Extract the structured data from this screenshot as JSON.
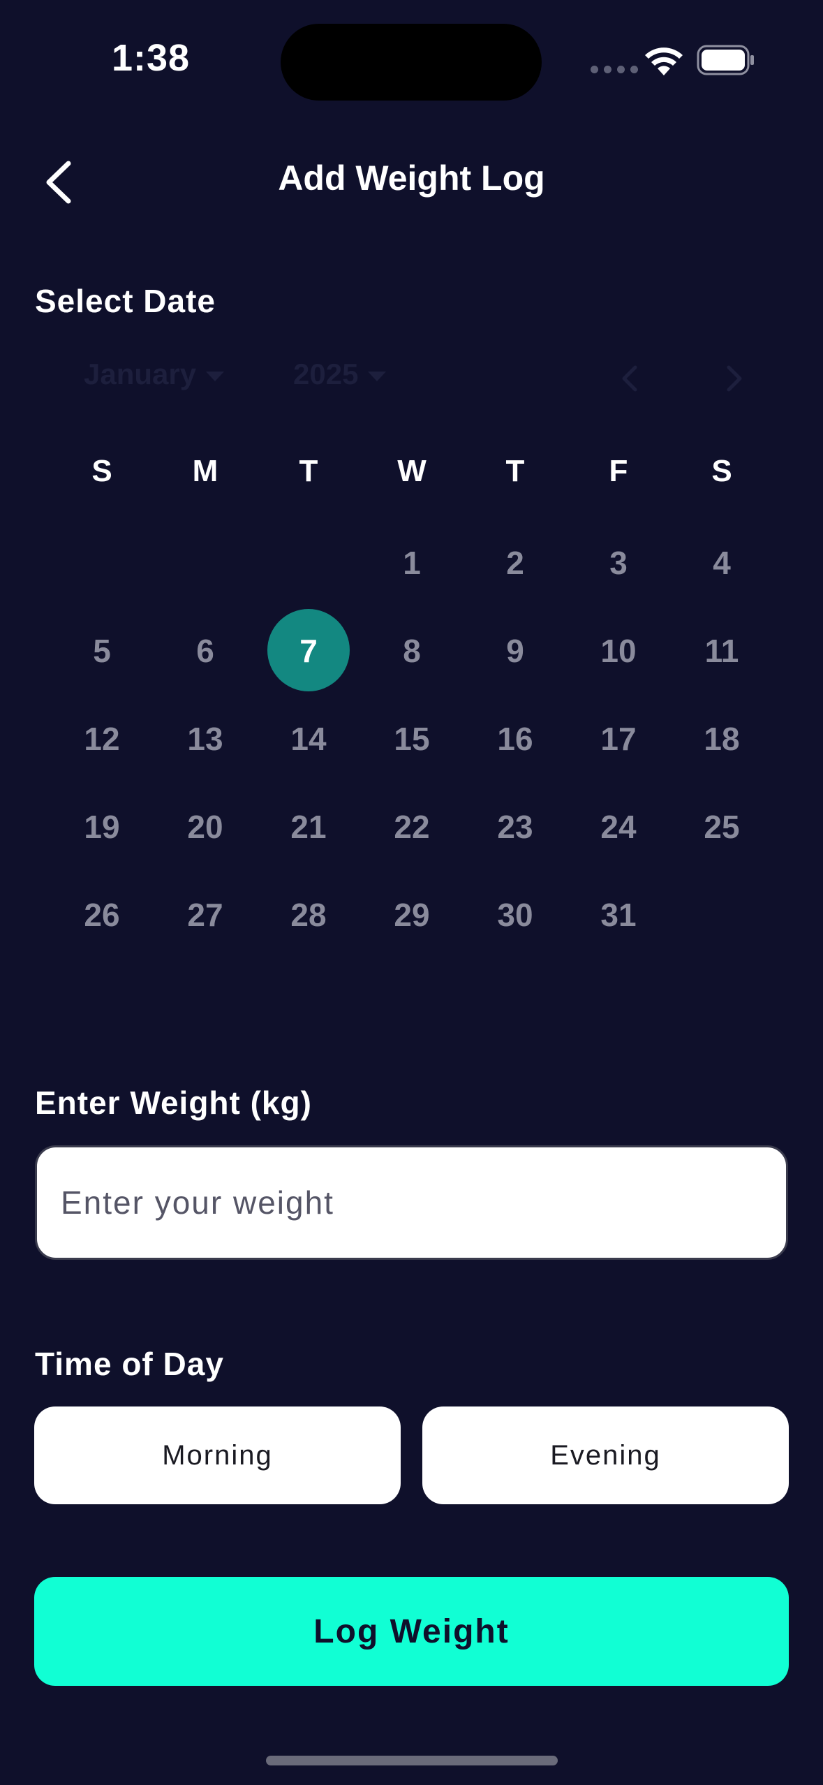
{
  "status_bar": {
    "time": "1:38"
  },
  "header": {
    "title": "Add Weight Log",
    "back_icon": "chevron-left-icon"
  },
  "date_section": {
    "label": "Select Date",
    "month": "January",
    "year": "2025",
    "weekdays": [
      "S",
      "M",
      "T",
      "W",
      "T",
      "F",
      "S"
    ],
    "first_weekday_index": 3,
    "days_in_month": 31,
    "selected_day": "7"
  },
  "weight_section": {
    "label": "Enter Weight (kg)",
    "placeholder": "Enter your weight",
    "value": ""
  },
  "time_section": {
    "label": "Time of Day",
    "morning_label": "Morning",
    "evening_label": "Evening"
  },
  "submit": {
    "label": "Log Weight"
  },
  "colors": {
    "background": "#0f102b",
    "selected_day": "#138881",
    "accent": "#11ffd4"
  }
}
